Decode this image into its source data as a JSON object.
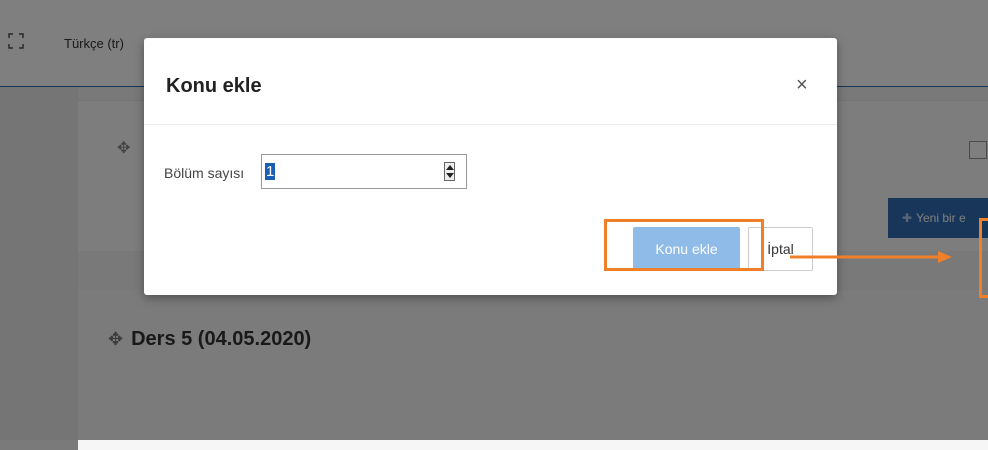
{
  "topbar": {
    "language": "Türkçe (tr)"
  },
  "background": {
    "new_button_label": "Yeni bir e",
    "section_title": "Ders 5 (04.05.2020)"
  },
  "modal": {
    "title": "Konu ekle",
    "close_glyph": "×",
    "field_label": "Bölüm sayısı",
    "field_value": "1",
    "add_button": "Konu ekle",
    "cancel_button": "İptal"
  },
  "icons": {
    "move": "✥",
    "plus": "✚"
  },
  "colors": {
    "accent": "#2f6db3",
    "annotation": "#f07f2a",
    "add_button": "#8fbbe9"
  }
}
